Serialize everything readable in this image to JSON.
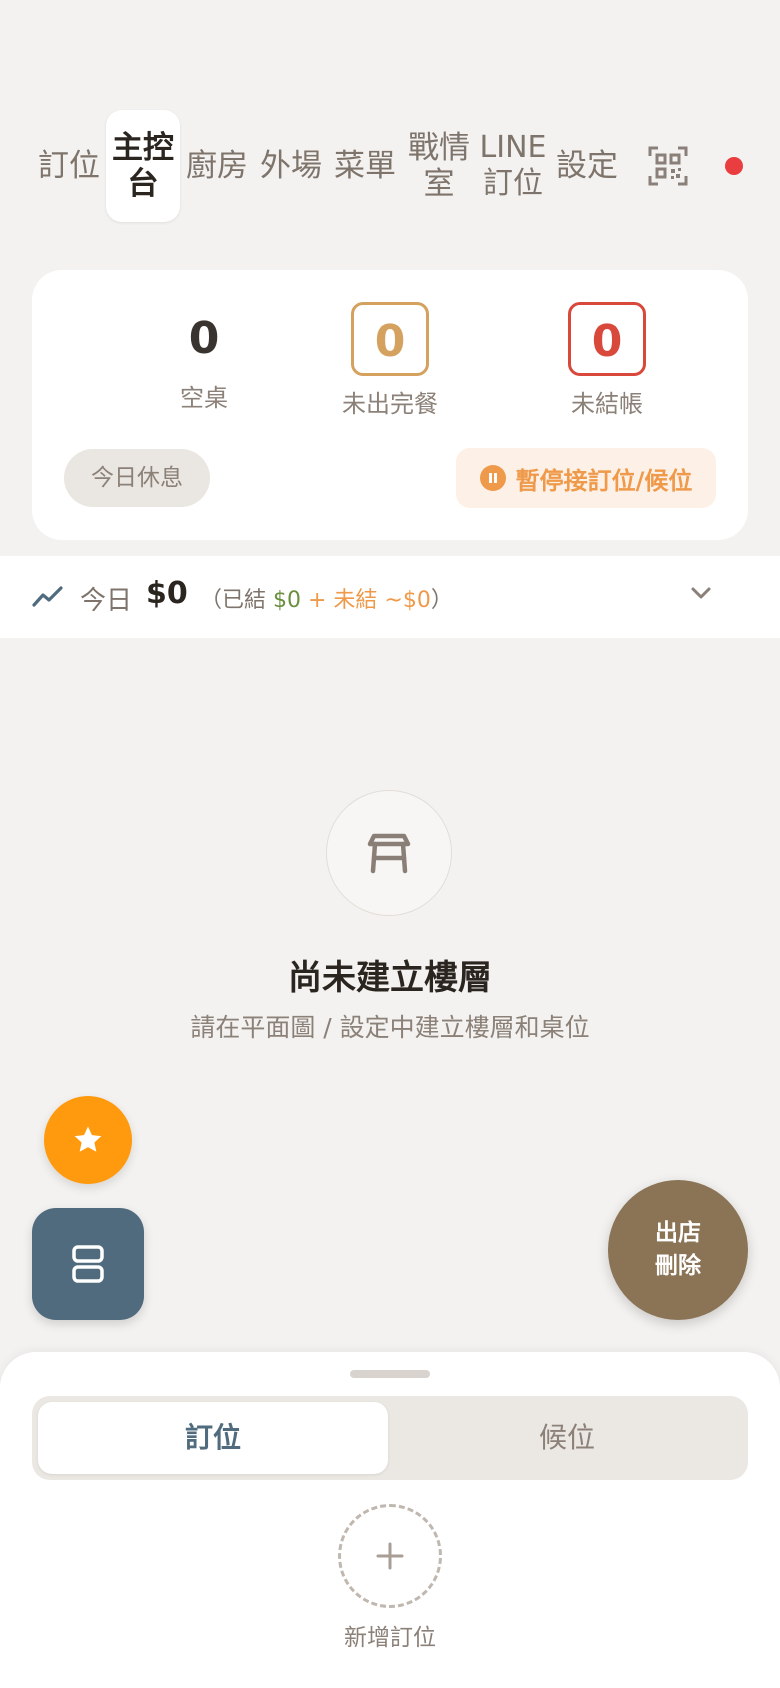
{
  "nav": {
    "tabs": [
      {
        "label": "訂位",
        "active": false
      },
      {
        "label": "主控\n台",
        "active": true
      },
      {
        "label": "廚房",
        "active": false
      },
      {
        "label": "外場",
        "active": false
      },
      {
        "label": "菜單",
        "active": false
      },
      {
        "label": "戰情\n室",
        "active": false
      },
      {
        "label": "LINE\n訂位",
        "active": false
      },
      {
        "label": "設定",
        "active": false
      }
    ],
    "qr_icon": "qr-scan-icon",
    "status_dot_color": "#ea3d3f"
  },
  "stats": {
    "empty_tables": {
      "value": "0",
      "label": "空桌"
    },
    "unserved": {
      "value": "0",
      "label": "未出完餐"
    },
    "unpaid": {
      "value": "0",
      "label": "未結帳"
    },
    "closed_today_label": "今日休息",
    "pause_label": "暫停接訂位/候位"
  },
  "revenue": {
    "label": "今日",
    "amount": "$0",
    "detail_prefix": "（已結 ",
    "settled": "$0",
    "plus": " + ",
    "unsettled": "未結 ~$0",
    "detail_suffix": "）"
  },
  "empty_state": {
    "icon": "table-icon",
    "title": "尚未建立樓層",
    "subtitle": "請在平面圖 / 設定中建立樓層和桌位"
  },
  "fab": {
    "star_icon": "star-icon",
    "layout_icon": "layout-icon",
    "checkout_label": "出店\n刪除"
  },
  "sheet": {
    "tabs": [
      {
        "label": "訂位",
        "active": true
      },
      {
        "label": "候位",
        "active": false
      }
    ],
    "add_label": "新增訂位"
  },
  "colors": {
    "accent_orange": "#ff9a0e",
    "slate": "#4f6b7d",
    "brown": "#8b7355",
    "warn": "#d4a15e",
    "alert": "#d9493b"
  }
}
